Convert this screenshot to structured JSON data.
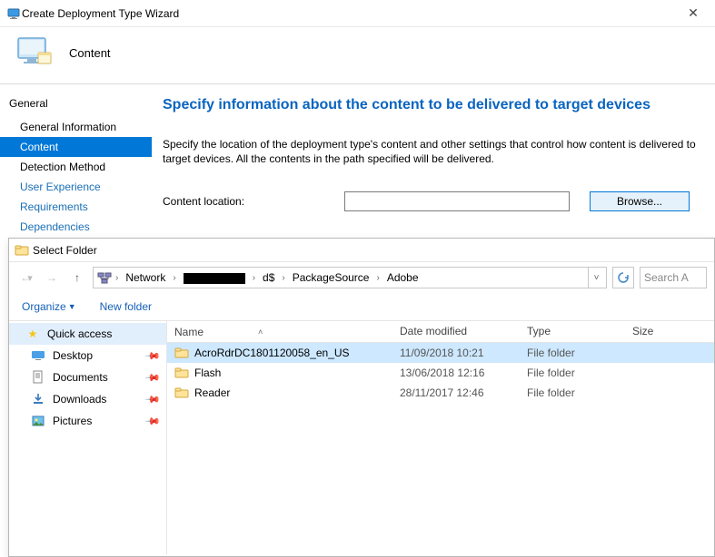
{
  "wizard": {
    "title": "Create Deployment Type Wizard",
    "step_label": "Content",
    "close": "✕",
    "nav_root": "General",
    "nav_items": [
      {
        "label": "General Information",
        "state": "past"
      },
      {
        "label": "Content",
        "state": "active"
      },
      {
        "label": "Detection Method",
        "state": "past"
      },
      {
        "label": "User Experience",
        "state": "future"
      },
      {
        "label": "Requirements",
        "state": "future"
      },
      {
        "label": "Dependencies",
        "state": "future"
      }
    ],
    "heading": "Specify information about the content to be delivered to target devices",
    "description": "Specify the location of the deployment type's content and other settings that control how content is delivered to target devices. All the contents in the path specified will be delivered.",
    "field_label": "Content location:",
    "content_value": "",
    "browse_label": "Browse..."
  },
  "folder": {
    "title": "Select Folder",
    "breadcrumb": [
      "Network",
      "[redacted]",
      "d$",
      "PackageSource",
      "Adobe"
    ],
    "search_placeholder": "Search A",
    "toolbar": {
      "organize": "Organize",
      "newfolder": "New folder"
    },
    "tree": {
      "quick": "Quick access",
      "items": [
        "Desktop",
        "Documents",
        "Downloads",
        "Pictures"
      ]
    },
    "columns": {
      "name": "Name",
      "date": "Date modified",
      "type": "Type",
      "size": "Size"
    },
    "rows": [
      {
        "name": "AcroRdrDC1801120058_en_US",
        "date": "11/09/2018 10:21",
        "type": "File folder",
        "size": "",
        "selected": true
      },
      {
        "name": "Flash",
        "date": "13/06/2018 12:16",
        "type": "File folder",
        "size": "",
        "selected": false
      },
      {
        "name": "Reader",
        "date": "28/11/2017 12:46",
        "type": "File folder",
        "size": "",
        "selected": false
      }
    ]
  }
}
